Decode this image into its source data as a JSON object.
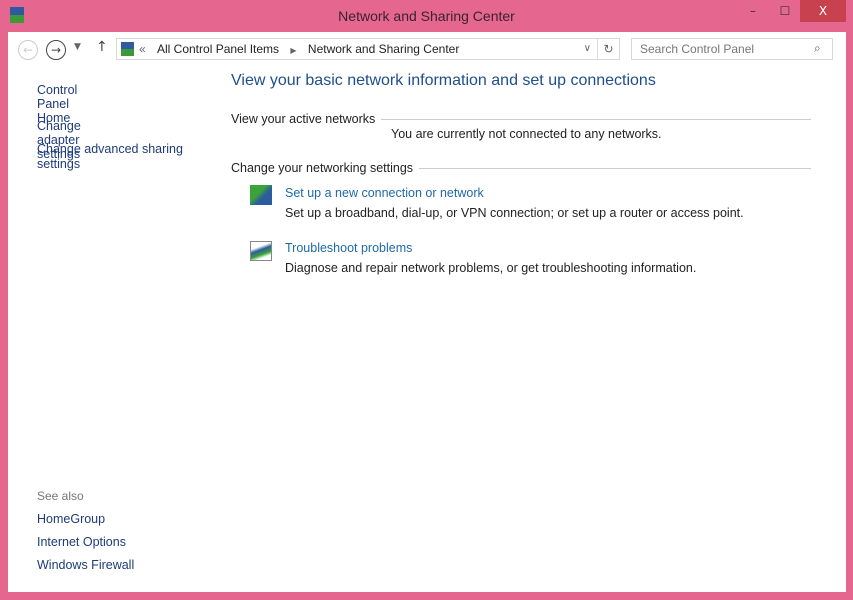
{
  "window": {
    "title": "Network and Sharing Center",
    "controls": {
      "minimize": "–",
      "maximize": "☐",
      "close": "X"
    }
  },
  "nav": {
    "address": [
      "All Control Panel Items",
      "Network and Sharing Center"
    ],
    "search_placeholder": "Search Control Panel"
  },
  "sidebar": {
    "items": [
      "Control Panel Home",
      "Change adapter settings",
      "Change advanced sharing settings"
    ],
    "see_also_label": "See also",
    "see_also": [
      "HomeGroup",
      "Internet Options",
      "Windows Firewall"
    ]
  },
  "main": {
    "heading": "View your basic network information and set up connections",
    "active_networks_label": "View your active networks",
    "not_connected": "You are currently not connected to any networks.",
    "change_settings_label": "Change your networking settings",
    "tasks": [
      {
        "title": "Set up a new connection or network",
        "desc": "Set up a broadband, dial-up, or VPN connection; or set up a router or access point."
      },
      {
        "title": "Troubleshoot problems",
        "desc": "Diagnose and repair network problems, or get troubleshooting information."
      }
    ]
  }
}
